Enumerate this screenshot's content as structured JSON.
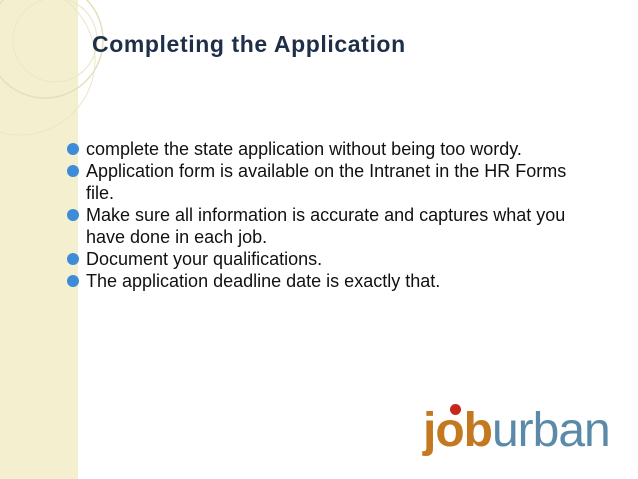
{
  "slide": {
    "title": "Completing the Application",
    "bullets": [
      "complete the state application without being too wordy.",
      "Application form is available on the Intranet in the HR Forms file.",
      "Make sure all information is accurate and captures what you have done in each job.",
      "Document your qualifications.",
      "The application deadline date is exactly that."
    ],
    "logo": {
      "part1": "job",
      "part2": "urban"
    }
  },
  "colors": {
    "title": "#1f2f48",
    "bullet": "#3e8bd8",
    "side_strip": "#f3efcf",
    "logo_job": "#c4781f",
    "logo_urban": "#5b8aa8",
    "logo_dot": "#c8271d"
  },
  "icons": [
    "bullet-dot-icon",
    "decorative-arc-icon",
    "logo-dot-icon"
  ]
}
